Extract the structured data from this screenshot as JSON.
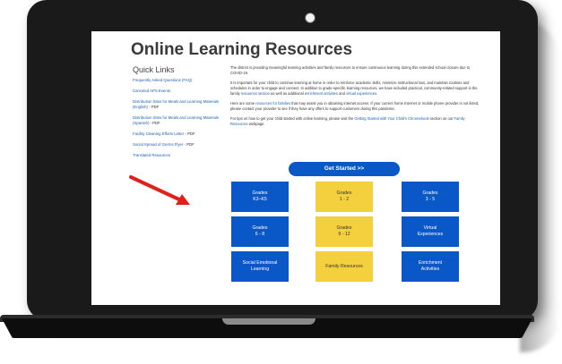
{
  "page": {
    "title": "Online Learning Resources",
    "quick_links_heading": "Quick Links",
    "quick_links": [
      {
        "text": "Frequently Asked Questions (FAQ)",
        "suffix": ""
      },
      {
        "text": "Canceled APS Events",
        "suffix": ""
      },
      {
        "text": "Distribution Sites for Meals and Learning Materials (English)",
        "suffix": " - PDF"
      },
      {
        "text": "Distribution Sites for Meals and Learning Materials (Spanish)",
        "suffix": " - PDF"
      },
      {
        "text": "Facility Cleaning Efforts Letter",
        "suffix": " - PDF"
      },
      {
        "text": "Social Spread of Germs Flyer",
        "suffix": " - PDF"
      },
      {
        "text": "Translated Resources",
        "suffix": ""
      }
    ],
    "intro": {
      "p1": "The district is providing meaningful learning activities and family resources to ensure continuous learning during this extended school closure due to COVID-19.",
      "p2a": "It is important for your child to continue learning at home in order to reinforce academic skills, minimize instructional loss, and maintain routines and schedules in order to engage and connect. In addition to grade-specific learning resources, we have included practical, community-related support in the family ",
      "p2_link1": "resources section",
      "p2b": " as well as additional ",
      "p2_link2": "enrichment activities",
      "p2c": " and ",
      "p2_link3": "virtual experiences",
      "p2d": ".",
      "p3a": "Here are some ",
      "p3_link": "resources for families",
      "p3b": " that may assist you in obtaining internet access. If your current home Internet or mobile phone provider is not listed, please contact your provider to see if they have any offers to support customers during this pandemic.",
      "p4a": "For tips on how to get your child started with online learning, please visit the ",
      "p4_link1": "Getting Started with Your Child's Chromebook",
      "p4b": " section on our ",
      "p4_link2": "Family Resources",
      "p4c": " webpage."
    },
    "get_started": "Get Started >>",
    "tiles": [
      {
        "label": "Grades\nK3–K5",
        "color": "blue"
      },
      {
        "label": "Grades\n1 - 2",
        "color": "yellow"
      },
      {
        "label": "Grades\n3 - 5",
        "color": "blue"
      },
      {
        "label": "Grades\n6 - 8",
        "color": "blue"
      },
      {
        "label": "Grades\n9 - 12",
        "color": "yellow"
      },
      {
        "label": "Virtual\nExperiences",
        "color": "blue"
      },
      {
        "label": "Social Emotional\nLearning",
        "color": "blue"
      },
      {
        "label": "Family Resources",
        "color": "yellow"
      },
      {
        "label": "Enrichment\nActivities",
        "color": "blue"
      }
    ]
  },
  "colors": {
    "tile_blue": "#0a58c8",
    "tile_yellow": "#f4d03f",
    "link_blue": "#1a5fb4",
    "arrow_red": "#e0201b",
    "laptop_body": "#1a1a1a"
  },
  "icons": [
    "camera-icon",
    "red-arrow-icon"
  ]
}
